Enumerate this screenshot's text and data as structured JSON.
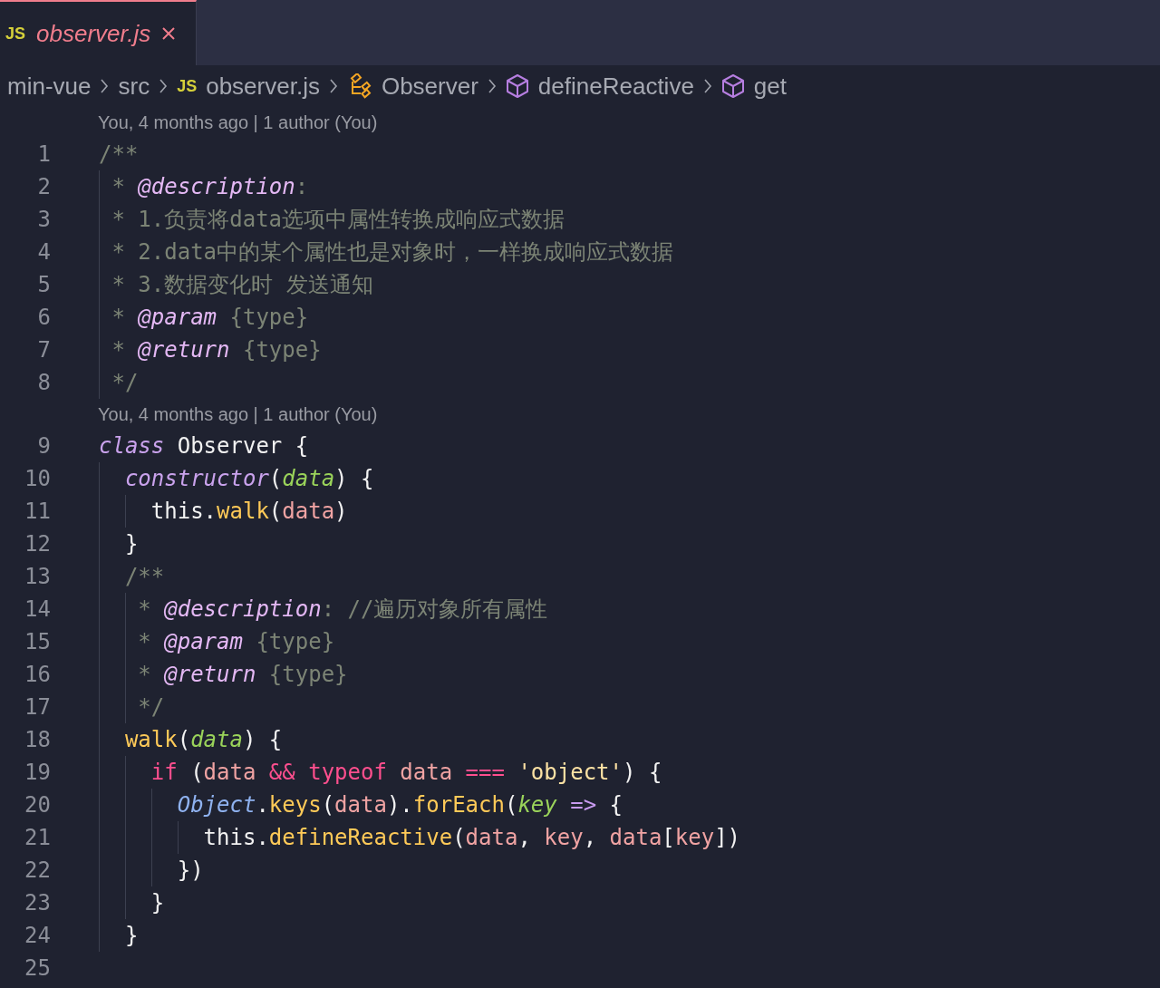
{
  "tabs": [
    {
      "label": "observer.js",
      "icon_text": "JS",
      "selected": true
    }
  ],
  "breadcrumb": [
    {
      "label": "min-vue",
      "kind": "folder"
    },
    {
      "label": "src",
      "kind": "folder"
    },
    {
      "label": "observer.js",
      "kind": "file",
      "icon_text": "JS"
    },
    {
      "label": "Observer",
      "kind": "class"
    },
    {
      "label": "defineReactive",
      "kind": "method"
    },
    {
      "label": "get",
      "kind": "method"
    }
  ],
  "lines": [
    {
      "kind": "lens",
      "text": "You, 4 months ago | 1 author (You)"
    },
    {
      "kind": "code",
      "number": "1",
      "tokens": [
        {
          "text": "/**",
          "kind": "comment"
        }
      ]
    },
    {
      "kind": "code",
      "number": "2",
      "tokens": [
        {
          "text": " * ",
          "kind": "comment"
        },
        {
          "text": "@description",
          "kind": "tag"
        },
        {
          "text": ":",
          "kind": "comment"
        }
      ]
    },
    {
      "kind": "code",
      "number": "3",
      "tokens": [
        {
          "text": " * 1.负责将data选项中属性转换成响应式数据",
          "kind": "comment"
        }
      ]
    },
    {
      "kind": "code",
      "number": "4",
      "tokens": [
        {
          "text": " * 2.data中的某个属性也是对象时，一样换成响应式数据",
          "kind": "comment"
        }
      ]
    },
    {
      "kind": "code",
      "number": "5",
      "tokens": [
        {
          "text": " * 3.数据变化时 发送通知",
          "kind": "comment"
        }
      ]
    },
    {
      "kind": "code",
      "number": "6",
      "tokens": [
        {
          "text": " * ",
          "kind": "comment"
        },
        {
          "text": "@param",
          "kind": "tag"
        },
        {
          "text": " {type}",
          "kind": "comment"
        }
      ]
    },
    {
      "kind": "code",
      "number": "7",
      "tokens": [
        {
          "text": " * ",
          "kind": "comment"
        },
        {
          "text": "@return",
          "kind": "tag"
        },
        {
          "text": " {type}",
          "kind": "comment"
        }
      ]
    },
    {
      "kind": "code",
      "number": "8",
      "tokens": [
        {
          "text": " */",
          "kind": "comment"
        }
      ]
    },
    {
      "kind": "lens",
      "text": "You, 4 months ago | 1 author (You)"
    },
    {
      "kind": "code",
      "number": "9",
      "tokens": [
        {
          "text": "class",
          "kind": "keyword"
        },
        {
          "text": " Observer {",
          "kind": "plain"
        }
      ]
    },
    {
      "kind": "code",
      "number": "10",
      "tokens": [
        {
          "text": "  constructor",
          "kind": "keyword"
        },
        {
          "text": "(",
          "kind": "plain"
        },
        {
          "text": "data",
          "kind": "param"
        },
        {
          "text": ") {",
          "kind": "plain"
        }
      ]
    },
    {
      "kind": "code",
      "number": "11",
      "tokens": [
        {
          "text": "    this.",
          "kind": "plain"
        },
        {
          "text": "walk",
          "kind": "fn"
        },
        {
          "text": "(",
          "kind": "plain"
        },
        {
          "text": "data",
          "kind": "var"
        },
        {
          "text": ")",
          "kind": "plain"
        }
      ]
    },
    {
      "kind": "code",
      "number": "12",
      "tokens": [
        {
          "text": "  }",
          "kind": "plain"
        }
      ]
    },
    {
      "kind": "code",
      "number": "13",
      "tokens": [
        {
          "text": "  /**",
          "kind": "comment"
        }
      ]
    },
    {
      "kind": "code",
      "number": "14",
      "tokens": [
        {
          "text": "   * ",
          "kind": "comment"
        },
        {
          "text": "@description",
          "kind": "tag"
        },
        {
          "text": ": //遍历对象所有属性",
          "kind": "comment"
        }
      ]
    },
    {
      "kind": "code",
      "number": "15",
      "tokens": [
        {
          "text": "   * ",
          "kind": "comment"
        },
        {
          "text": "@param",
          "kind": "tag"
        },
        {
          "text": " {type}",
          "kind": "comment"
        }
      ]
    },
    {
      "kind": "code",
      "number": "16",
      "tokens": [
        {
          "text": "   * ",
          "kind": "comment"
        },
        {
          "text": "@return",
          "kind": "tag"
        },
        {
          "text": " {type}",
          "kind": "comment"
        }
      ]
    },
    {
      "kind": "code",
      "number": "17",
      "tokens": [
        {
          "text": "   */",
          "kind": "comment"
        }
      ]
    },
    {
      "kind": "code",
      "number": "18",
      "tokens": [
        {
          "text": "  walk",
          "kind": "fn"
        },
        {
          "text": "(",
          "kind": "plain"
        },
        {
          "text": "data",
          "kind": "param"
        },
        {
          "text": ") {",
          "kind": "plain"
        }
      ]
    },
    {
      "kind": "code",
      "number": "19",
      "tokens": [
        {
          "text": "    if",
          "kind": "op"
        },
        {
          "text": " (",
          "kind": "plain"
        },
        {
          "text": "data",
          "kind": "var"
        },
        {
          "text": " &&",
          "kind": "op"
        },
        {
          "text": " typeof",
          "kind": "op"
        },
        {
          "text": " data",
          "kind": "var"
        },
        {
          "text": " ===",
          "kind": "op"
        },
        {
          "text": " 'object'",
          "kind": "string"
        },
        {
          "text": ") {",
          "kind": "plain"
        }
      ]
    },
    {
      "kind": "code",
      "number": "20",
      "tokens": [
        {
          "text": "      Object",
          "kind": "cls"
        },
        {
          "text": ".",
          "kind": "plain"
        },
        {
          "text": "keys",
          "kind": "fn"
        },
        {
          "text": "(",
          "kind": "plain"
        },
        {
          "text": "data",
          "kind": "var"
        },
        {
          "text": ").",
          "kind": "plain"
        },
        {
          "text": "forEach",
          "kind": "fn"
        },
        {
          "text": "(",
          "kind": "plain"
        },
        {
          "text": "key",
          "kind": "param"
        },
        {
          "text": " =>",
          "kind": "arrow"
        },
        {
          "text": " {",
          "kind": "plain"
        }
      ]
    },
    {
      "kind": "code",
      "number": "21",
      "tokens": [
        {
          "text": "        this.",
          "kind": "plain"
        },
        {
          "text": "defineReactive",
          "kind": "fn"
        },
        {
          "text": "(",
          "kind": "plain"
        },
        {
          "text": "data",
          "kind": "var"
        },
        {
          "text": ", ",
          "kind": "plain"
        },
        {
          "text": "key",
          "kind": "var"
        },
        {
          "text": ", ",
          "kind": "plain"
        },
        {
          "text": "data",
          "kind": "var"
        },
        {
          "text": "[",
          "kind": "plain"
        },
        {
          "text": "key",
          "kind": "var"
        },
        {
          "text": "])",
          "kind": "plain"
        }
      ]
    },
    {
      "kind": "code",
      "number": "22",
      "tokens": [
        {
          "text": "      })",
          "kind": "plain"
        }
      ]
    },
    {
      "kind": "code",
      "number": "23",
      "tokens": [
        {
          "text": "    }",
          "kind": "plain"
        }
      ]
    },
    {
      "kind": "code",
      "number": "24",
      "tokens": [
        {
          "text": "  }",
          "kind": "plain"
        }
      ]
    },
    {
      "kind": "code",
      "number": "25"
    }
  ]
}
